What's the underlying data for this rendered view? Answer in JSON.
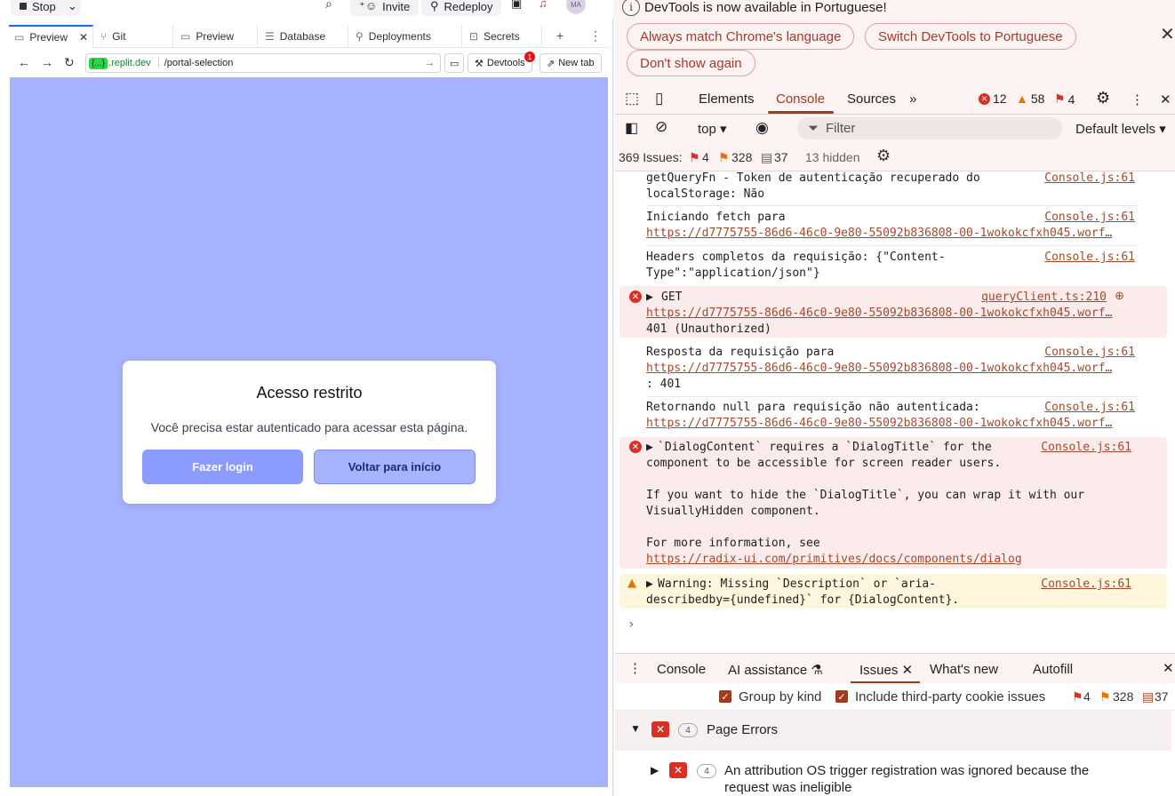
{
  "replit": {
    "stop_label": "Stop",
    "invite_label": "Invite",
    "redeploy_label": "Redeploy",
    "avatar_initials": "MA",
    "tabs": [
      "Preview",
      "Git",
      "Preview",
      "Database",
      "Deployments",
      "Secrets"
    ],
    "url_host_pill": "{...}",
    "url_host": ".replit.dev",
    "url_path": "/portal-selection",
    "devtools_label": "Devtools",
    "devtools_badge": "1",
    "newtab_label": "New tab",
    "accent": "#a7b3ff"
  },
  "modal": {
    "title": "Acesso restrito",
    "text": "Você precisa estar autenticado para acessar esta página.",
    "login_label": "Fazer login",
    "back_label": "Voltar para início"
  },
  "devtools": {
    "info_text": "DevTools is now available in Portuguese!",
    "pill_match": "Always match Chrome's language",
    "pill_switch": "Switch DevTools to Portuguese",
    "pill_dont": "Don't show again",
    "tabs": [
      "Elements",
      "Console",
      "Sources"
    ],
    "errors_count": "12",
    "warnings_count": "58",
    "issues_count": "4",
    "context": "top",
    "filter_placeholder": "Filter",
    "levels": "Default levels",
    "issues_summary": "369 Issues:",
    "issues_err": "4",
    "issues_warn": "328",
    "issues_info": "37",
    "hidden": "13 hidden",
    "messages": {
      "m1_l1": "getQueryFn - Token de autenticação recuperado do",
      "m1_l2": "localStorage: Não",
      "m2_l1": "Iniciando fetch para",
      "m3_l1": "Headers completos da requisição: {\"Content-",
      "m3_l2": "Type\":\"application/json\"}",
      "m4_l1": "GET",
      "m4_l3": "401 (Unauthorized)",
      "m4_src": "queryClient.ts:210",
      "m5_l1": "Resposta da requisição para",
      "m5_l3": ": 401",
      "m6_l1": "Retornando null para requisição não autenticada:",
      "m7_l1": "`DialogContent` requires a `DialogTitle` for the",
      "m7_l2": "component to be accessible for screen reader users.",
      "m7_l3": "If you want to hide the `DialogTitle`, you can wrap it with our",
      "m7_l4": "VisuallyHidden component.",
      "m7_l5": "For more information, see",
      "m7_url": "https://radix-ui.com/primitives/docs/components/dialog",
      "m8_l1": "Warning: Missing `Description` or `aria-",
      "m8_l2": "describedby={undefined}` for {DialogContent}.",
      "src": "Console.js:61",
      "long_url": "https://d7775755-86d6-46c0-9e80-55092b836808-00-1wokokcfxh045.worf…"
    },
    "drawer_tabs": [
      "Console",
      "AI assistance",
      "Issues",
      "What's new",
      "Autofill"
    ],
    "group_by_kind": "Group by kind",
    "third_party": "Include third-party cookie issues",
    "page_errors": "Page Errors",
    "page_errors_count": "4",
    "issue1_count": "4",
    "issue1_l1": "An attribution OS trigger registration was ignored because the",
    "issue1_l2": "request was ineligible"
  }
}
